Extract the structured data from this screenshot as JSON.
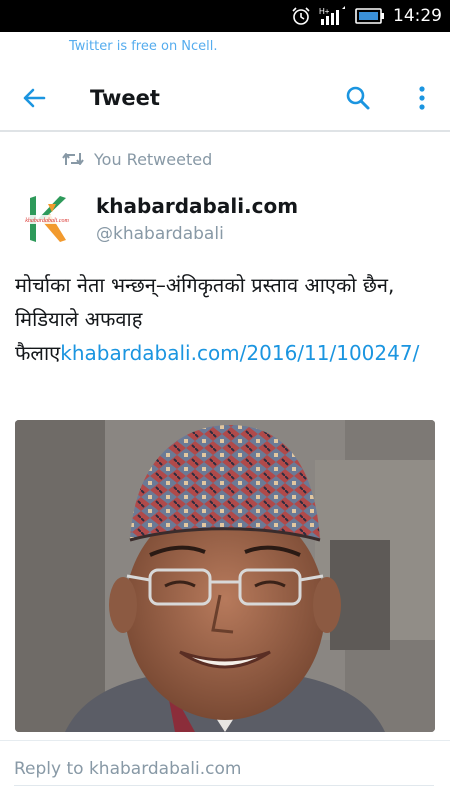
{
  "status_bar": {
    "time": "14:29",
    "network_label": "H+",
    "icons": [
      "alarm-icon",
      "signal-icon",
      "battery-icon"
    ]
  },
  "promo_banner": {
    "text": "Twitter is free on Ncell."
  },
  "app_bar": {
    "title": "Tweet",
    "icons": [
      "back-arrow-icon",
      "search-icon",
      "more-vertical-icon"
    ]
  },
  "retweet": {
    "label": "You Retweeted",
    "icon": "retweet-icon"
  },
  "author": {
    "name": "khabardabali.com",
    "handle": "@khabardabali",
    "avatar_logo_text": "khabardabali.com"
  },
  "tweet": {
    "text": "मोर्चाका नेता भन्छन्–अंगिकृतको प्रस्ताव आएको छैन, मिडियाले अफवाह फैलाए",
    "link": "khabardabali.com/2016/11/100247/"
  },
  "media": {
    "description_icon": "photo-of-man-in-dhaka-topi"
  },
  "reply": {
    "placeholder": "Reply to khabardabali.com"
  },
  "colors": {
    "accent": "#1b95e0",
    "promo": "#55acee",
    "secondary_text": "#8899a6",
    "status_bar_bg": "#000000"
  }
}
